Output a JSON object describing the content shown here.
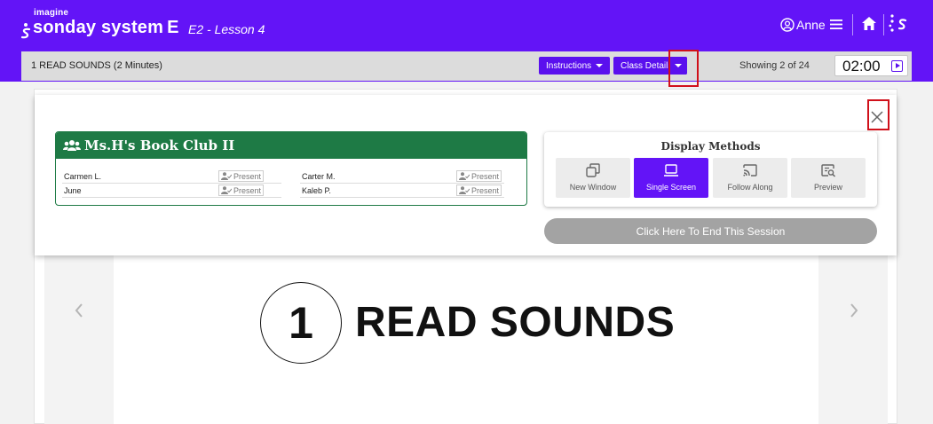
{
  "header": {
    "brand_small": "imagine",
    "brand_main": "sonday system",
    "brand_suffix": "E",
    "lesson": "E2 - Lesson 4",
    "user_name": "Anne",
    "accent_color": "#6314f7"
  },
  "subheader": {
    "activity_title": "1 READ SOUNDS (2 Minutes)",
    "instructions_label": "Instructions",
    "class_details_label": "Class Details",
    "showing": "Showing 2 of 24",
    "timer": "02:00"
  },
  "class_panel": {
    "club_name": "Ms.H's Book Club II",
    "club_color": "#1e7a45",
    "students": [
      {
        "name": "Carmen L.",
        "status": "Present"
      },
      {
        "name": "June",
        "status": "Present"
      },
      {
        "name": "Carter M.",
        "status": "Present"
      },
      {
        "name": "Kaleb P.",
        "status": "Present"
      }
    ],
    "display_methods": {
      "title": "Display Methods",
      "options": [
        {
          "label": "New Window",
          "icon": "new-window-icon",
          "active": false
        },
        {
          "label": "Single Screen",
          "icon": "laptop-icon",
          "active": true
        },
        {
          "label": "Follow Along",
          "icon": "cast-icon",
          "active": false
        },
        {
          "label": "Preview",
          "icon": "preview-icon",
          "active": false
        }
      ]
    },
    "end_session_label": "Click Here To End This Session"
  },
  "slide": {
    "number": "1",
    "title": "READ SOUNDS"
  }
}
